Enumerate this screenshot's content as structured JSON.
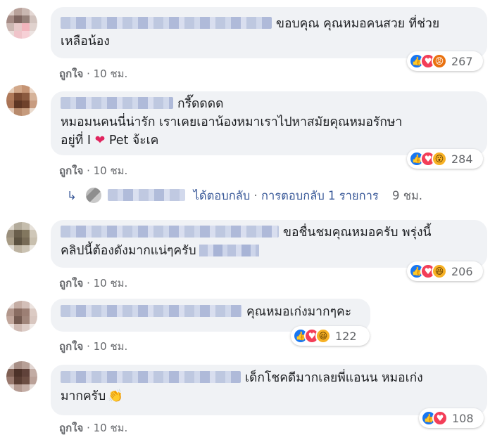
{
  "comments": [
    {
      "text_line1": "ขอบคุณ คุณหมอคนสวย ที่ช่วย",
      "text_line2": "เหลือน้อง",
      "like_label": "ถูกใจ",
      "time": "10 ชม.",
      "reaction_count": "267"
    },
    {
      "text_line1": "กรี๊ดดดด",
      "text_line2": "หมอมนคนนี่น่ารัก เราเคยเอาน้องหมาเราไปหาสมัยคุณหมอรักษา",
      "text_line3a": "อยู่ที่ I",
      "text_line3b": "Pet จ้ะเค",
      "like_label": "ถูกใจ",
      "time": "10 ชม.",
      "reaction_count": "284"
    },
    {
      "text_line1": "ขอชื่นชมคุณหมอครับ พรุ่งนี้",
      "text_line2": "คลิปนี้ต้องดังมากแน่ๆครับ",
      "like_label": "ถูกใจ",
      "time": "10 ชม.",
      "reaction_count": "206"
    },
    {
      "text_line1": "คุณหมอเก่งมากๆคะ",
      "like_label": "ถูกใจ",
      "time": "10 ชม.",
      "reaction_count": "122"
    },
    {
      "text_line1": "เด็กโชคดีมากเลยพี่แอนน หมอเก่ง",
      "text_line2": "มากครับ",
      "like_label": "ถูกใจ",
      "time": "10 ชม.",
      "reaction_count": "108"
    }
  ],
  "reply": {
    "replied_label": "ได้ตอบกลับ",
    "separator": "·",
    "replies_label": "การตอบกลับ 1 รายการ",
    "time": "9 ชม."
  },
  "icons": {
    "like": "like-icon",
    "love": "love-icon",
    "angry": "angry-icon",
    "wow": "wow-icon",
    "haha": "haha-icon",
    "clap": "clapping-hands-icon",
    "heart": "red-heart-icon",
    "reply_arrow": "reply-arrow-icon"
  },
  "colors": {
    "link": "#385898",
    "meta": "#65676b",
    "bubble": "#f0f2f5",
    "like": "#1877f2",
    "love": "#f33e58"
  }
}
